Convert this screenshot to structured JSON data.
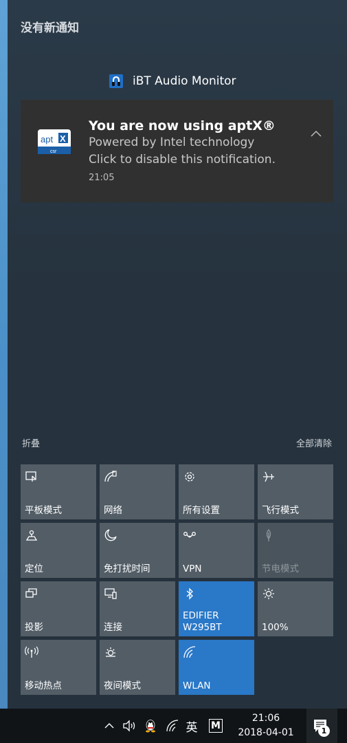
{
  "header": {
    "title": "没有新通知"
  },
  "notification_group": {
    "app_name": "iBT Audio Monitor",
    "app_icon": "audio-app-icon",
    "card": {
      "logo": "aptx-logo-icon",
      "title": "You are now using aptX®",
      "line1": "Powered by Intel technology",
      "line2": "Click to disable this notification.",
      "time": "21:05"
    }
  },
  "actions": {
    "collapse": "折叠",
    "clear_all": "全部清除"
  },
  "quick_actions": [
    {
      "label": "平板模式",
      "icon": "tablet-mode-icon",
      "state": "off"
    },
    {
      "label": "网络",
      "icon": "network-icon",
      "state": "off"
    },
    {
      "label": "所有设置",
      "icon": "settings-gear-icon",
      "state": "off"
    },
    {
      "label": "飞行模式",
      "icon": "airplane-icon",
      "state": "off"
    },
    {
      "label": "定位",
      "icon": "location-icon",
      "state": "off"
    },
    {
      "label": "免打扰时间",
      "icon": "moon-icon",
      "state": "off"
    },
    {
      "label": "VPN",
      "icon": "vpn-icon",
      "state": "off"
    },
    {
      "label": "节电模式",
      "icon": "battery-saver-icon",
      "state": "disabled"
    },
    {
      "label": "投影",
      "icon": "project-icon",
      "state": "off"
    },
    {
      "label": "连接",
      "icon": "connect-icon",
      "state": "off"
    },
    {
      "label": "EDIFIER\nW295BT",
      "icon": "bluetooth-icon",
      "state": "on"
    },
    {
      "label": "100%",
      "icon": "brightness-icon",
      "state": "off"
    },
    {
      "label": "移动热点",
      "icon": "hotspot-icon",
      "state": "off"
    },
    {
      "label": "夜间模式",
      "icon": "night-light-icon",
      "state": "off"
    },
    {
      "label": "WLAN",
      "icon": "wifi-icon",
      "state": "on"
    }
  ],
  "taskbar": {
    "ime": "英",
    "m_icon": "M",
    "time": "21:06",
    "date": "2018-04-01",
    "notification_count": "1"
  },
  "colors": {
    "panel_bg": "#26333f",
    "card_bg": "#303030",
    "tile_bg": "#525d66",
    "tile_active": "#2a78c8",
    "taskbar_bg": "#101417"
  }
}
